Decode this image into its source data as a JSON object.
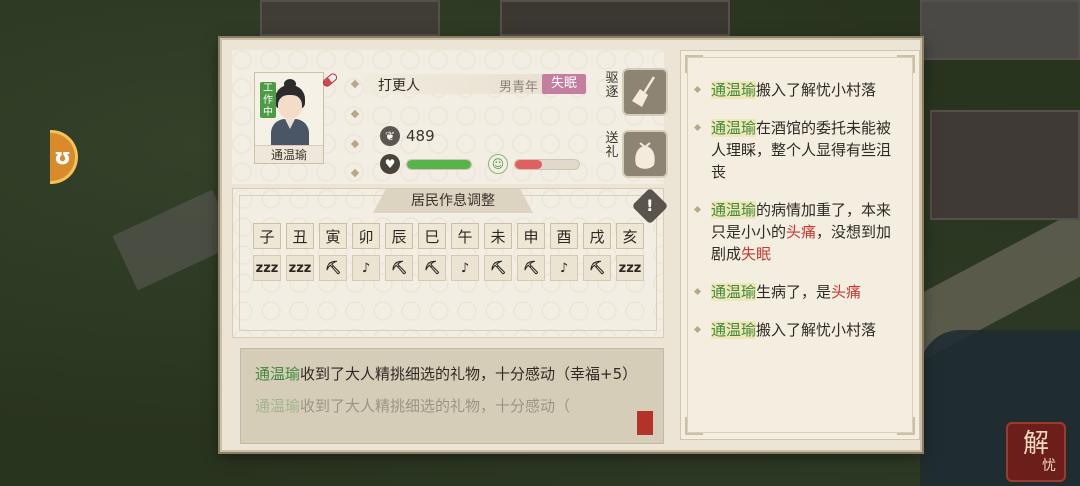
{
  "resident": {
    "name": "通温瑜",
    "work_badge": "工作中",
    "job": "打更人",
    "meta": "男青年",
    "status": "失眠",
    "currency": "489",
    "health_percent": 100,
    "mood_percent": 42
  },
  "actions": {
    "expel": "驱逐",
    "gift": "送礼"
  },
  "schedule": {
    "title": "居民作息调整",
    "hours": [
      "子",
      "丑",
      "寅",
      "卯",
      "辰",
      "巳",
      "午",
      "未",
      "申",
      "酉",
      "戌",
      "亥"
    ],
    "activities": [
      {
        "label": "zzz",
        "icon": "sleep-icon"
      },
      {
        "label": "zzz",
        "icon": "sleep-icon"
      },
      {
        "label": "⛏",
        "icon": "pickaxe-icon"
      },
      {
        "label": "♪",
        "icon": "leisure-icon"
      },
      {
        "label": "⛏",
        "icon": "pickaxe-icon"
      },
      {
        "label": "⛏",
        "icon": "pickaxe-icon"
      },
      {
        "label": "♪",
        "icon": "leisure-icon"
      },
      {
        "label": "⛏",
        "icon": "pickaxe-icon"
      },
      {
        "label": "⛏",
        "icon": "pickaxe-icon"
      },
      {
        "label": "♪",
        "icon": "leisure-icon"
      },
      {
        "label": "⛏",
        "icon": "pickaxe-icon"
      },
      {
        "label": "zzz",
        "icon": "sleep-icon"
      }
    ]
  },
  "log": [
    {
      "who": "通温瑜",
      "text": "收到了大人精挑细选的礼物，十分感动（幸福+5）"
    },
    {
      "who": "通温瑜",
      "text": "收到了大人精挑细选的礼物，十分感动（"
    }
  ],
  "news": [
    {
      "who": "通温瑜",
      "text": "搬入了解忧小村落",
      "sick": "",
      "tail": ""
    },
    {
      "who": "通温瑜",
      "text": "在酒馆的委托未能被人理睬，整个人显得有些沮丧",
      "sick": "",
      "tail": ""
    },
    {
      "who": "通温瑜",
      "text": "的病情加重了，本来只是小小的",
      "sick": "头痛",
      "tail": "，没想到加剧成",
      "sick2": "失眠"
    },
    {
      "who": "通温瑜",
      "text": "生病了，是",
      "sick": "头痛",
      "tail": ""
    },
    {
      "who": "通温瑜",
      "text": "搬入了解忧小村落",
      "sick": "",
      "tail": ""
    }
  ],
  "colors": {
    "green": "#3f8a3b",
    "red": "#c53b32",
    "status_pink": "#c47fa0"
  },
  "logo": {
    "big": "解",
    "small": "忧"
  }
}
